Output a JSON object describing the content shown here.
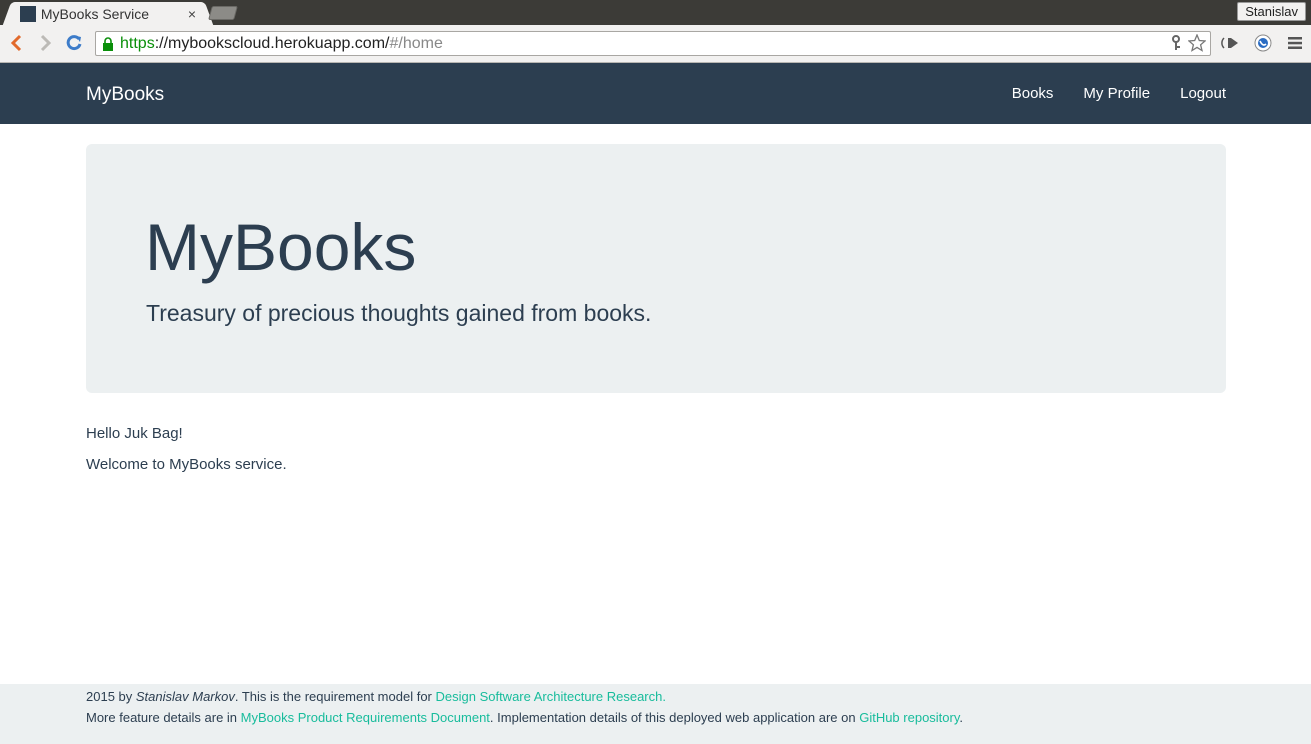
{
  "browser": {
    "tab_title": "MyBooks Service",
    "tab_close": "×",
    "profile_name": "Stanislav",
    "url_scheme": "https",
    "url_host": "://mybookscloud.herokuapp.com/",
    "url_path": "#/home"
  },
  "navbar": {
    "brand": "MyBooks",
    "links": [
      "Books",
      "My Profile",
      "Logout"
    ]
  },
  "jumbotron": {
    "title": "MyBooks",
    "subtitle": "Treasury of precious thoughts gained from books."
  },
  "main": {
    "greeting": "Hello Juk Bag!",
    "welcome": "Welcome to MyBooks service."
  },
  "footer": {
    "line1_prefix": "2015 by ",
    "author": "Stanislav Markov",
    "line1_middle": ". This is the requirement model for ",
    "research_link": "Design Software Architecture Research.",
    "line2_prefix": "More feature details are in ",
    "prd_link": "MyBooks Product Requirements Document",
    "line2_middle": ". Implementation details of this deployed web application are on ",
    "github_link": "GitHub repository",
    "line2_suffix": "."
  },
  "colors": {
    "navbar_bg": "#2c3e50",
    "jumbotron_bg": "#ecf0f1",
    "link": "#18bc9c"
  }
}
